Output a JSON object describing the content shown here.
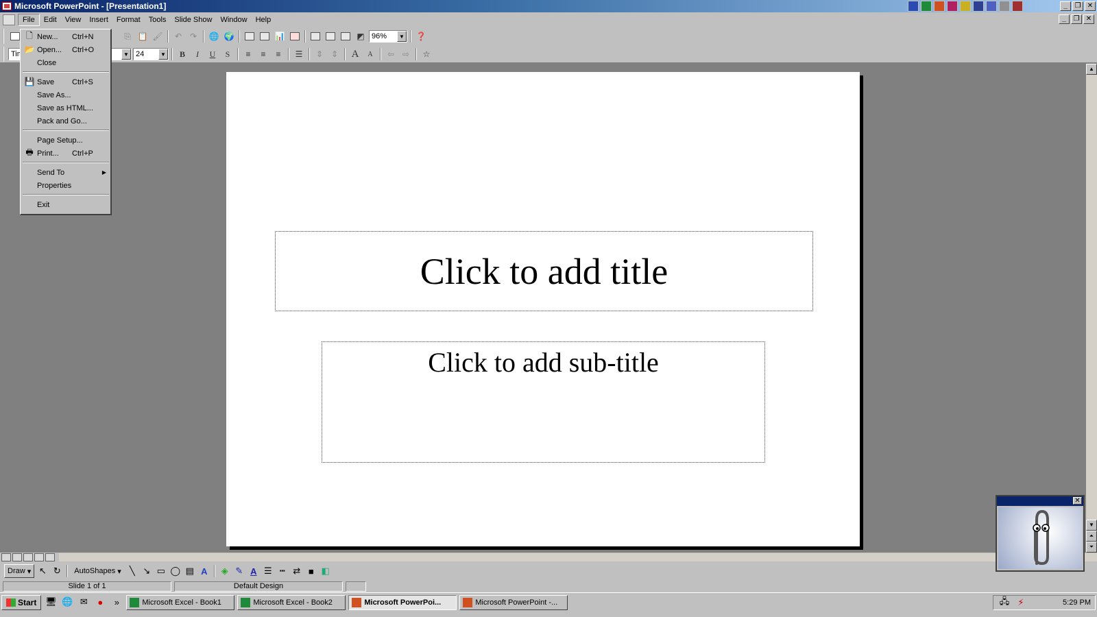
{
  "window": {
    "title": "Microsoft PowerPoint - [Presentation1]"
  },
  "menubar": {
    "items": [
      {
        "label": "File"
      },
      {
        "label": "Edit"
      },
      {
        "label": "View"
      },
      {
        "label": "Insert"
      },
      {
        "label": "Format"
      },
      {
        "label": "Tools"
      },
      {
        "label": "Slide Show"
      },
      {
        "label": "Window"
      },
      {
        "label": "Help"
      }
    ]
  },
  "toolbar": {
    "zoom": "96%",
    "font_name": "Tim",
    "font_size": "24"
  },
  "file_menu": {
    "items": [
      {
        "label": "New...",
        "shortcut": "Ctrl+N"
      },
      {
        "label": "Open...",
        "shortcut": "Ctrl+O"
      },
      {
        "label": "Close",
        "shortcut": ""
      },
      {
        "label": "Save",
        "shortcut": "Ctrl+S"
      },
      {
        "label": "Save As...",
        "shortcut": ""
      },
      {
        "label": "Save as HTML...",
        "shortcut": ""
      },
      {
        "label": "Pack and Go...",
        "shortcut": ""
      },
      {
        "label": "Page Setup...",
        "shortcut": ""
      },
      {
        "label": "Print...",
        "shortcut": "Ctrl+P"
      },
      {
        "label": "Send To",
        "shortcut": ""
      },
      {
        "label": "Properties",
        "shortcut": ""
      },
      {
        "label": "Exit",
        "shortcut": ""
      }
    ]
  },
  "slide": {
    "title_placeholder": "Click to add title",
    "subtitle_placeholder": "Click to add sub-title"
  },
  "drawing_toolbar": {
    "draw_label": "Draw",
    "autoshapes_label": "AutoShapes"
  },
  "status": {
    "slide_indicator": "Slide 1 of 1",
    "design": "Default Design"
  },
  "taskbar": {
    "start_label": "Start",
    "tasks": [
      {
        "label": "Microsoft Excel - Book1"
      },
      {
        "label": "Microsoft Excel - Book2"
      },
      {
        "label": "Microsoft PowerPoi..."
      },
      {
        "label": "Microsoft PowerPoint -..."
      }
    ],
    "clock": "5:29 PM"
  },
  "colors": {
    "titlebar": "#0a246a",
    "face": "#c0c0c0",
    "workspace": "#808080"
  }
}
